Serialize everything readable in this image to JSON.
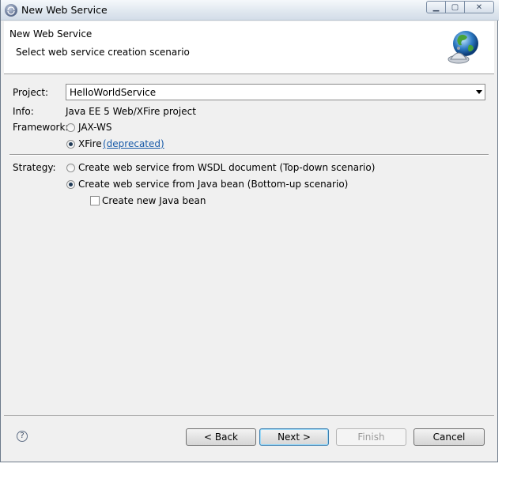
{
  "window": {
    "title": "New Web Service"
  },
  "header": {
    "title": "New Web Service",
    "subtitle": "Select web service creation scenario"
  },
  "form": {
    "project_label": "Project:",
    "project_value": "HelloWorldService",
    "info_label": "Info:",
    "info_value": "Java EE 5 Web/XFire project",
    "framework_label": "Framework:",
    "framework_options": [
      {
        "label": "JAX-WS",
        "selected": false
      },
      {
        "label": "XFire",
        "selected": true,
        "link": "(deprecated)"
      }
    ],
    "strategy_label": "Strategy:",
    "strategy_options": [
      {
        "label": "Create web service from WSDL document (Top-down scenario)",
        "selected": false
      },
      {
        "label": "Create web service from Java bean (Bottom-up scenario)",
        "selected": true
      }
    ],
    "create_bean_label": "Create new Java bean",
    "create_bean_checked": false
  },
  "buttons": {
    "back": "< Back",
    "next": "Next >",
    "finish": "Finish",
    "cancel": "Cancel"
  },
  "icons": {
    "help": "question-mark-icon",
    "globe": "globe-service-bell-icon"
  }
}
